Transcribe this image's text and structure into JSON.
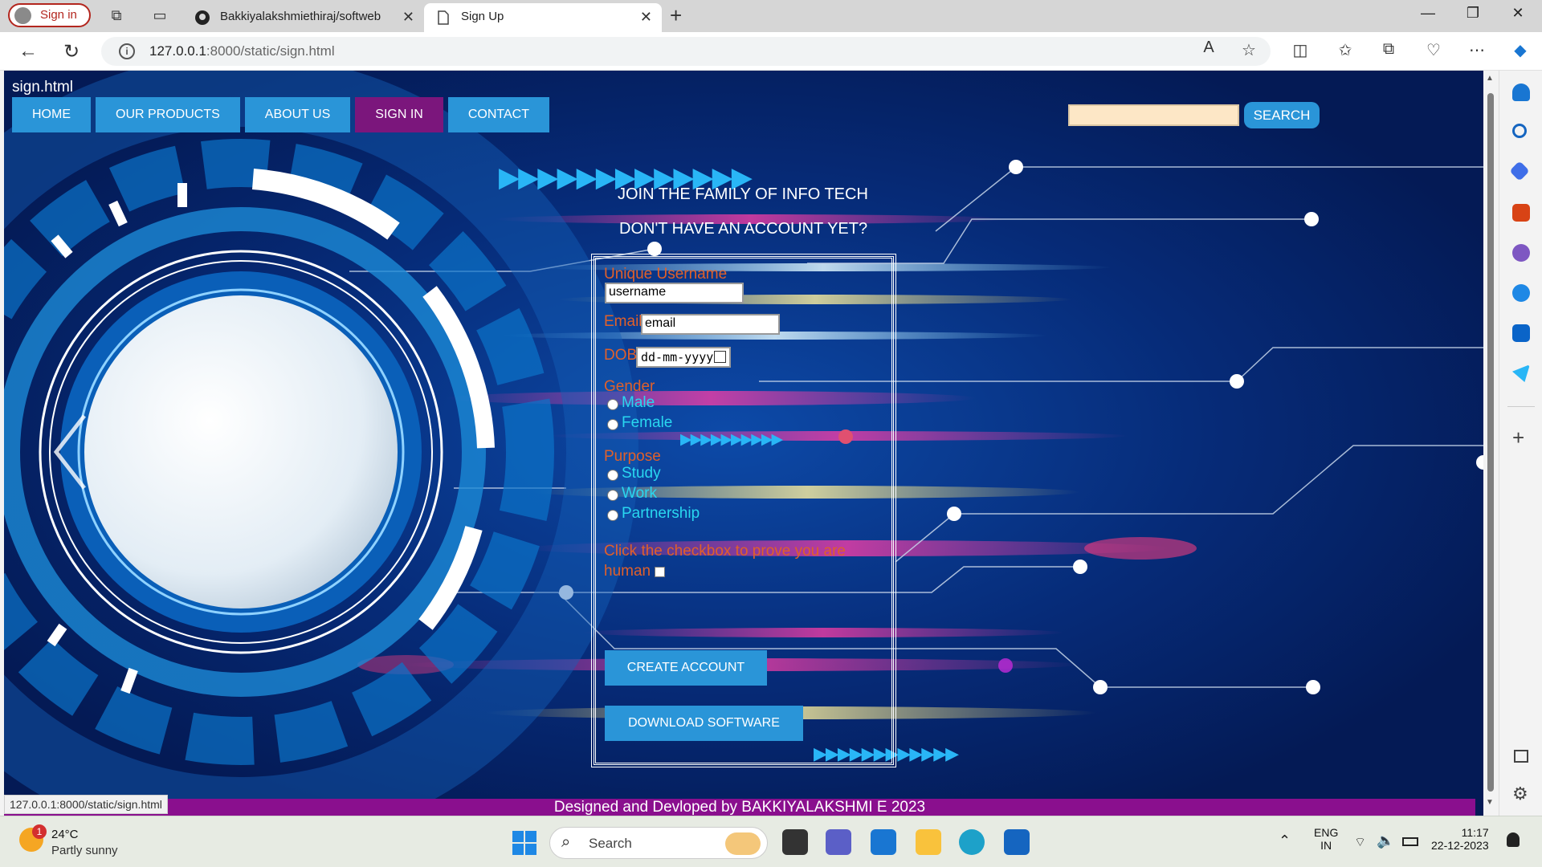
{
  "browser": {
    "profile_label": "Sign in",
    "tabs": [
      {
        "title": "Bakkiyalakshmiethiraj/softweb",
        "active": false
      },
      {
        "title": "Sign Up",
        "active": true
      }
    ],
    "url": "127.0.0.1:8000/static/sign.html",
    "url_host": "127.0.0.1",
    "url_path": ":8000/static/sign.html"
  },
  "page": {
    "title": "sign.html",
    "nav": [
      "HOME",
      "OUR PRODUCTS",
      "ABOUT US",
      "SIGN IN",
      "CONTACT"
    ],
    "search_button": "SEARCH",
    "heading_join": "JOIN THE FAMILY OF INFO TECH",
    "heading_account": "DON'T HAVE AN ACCOUNT YET?",
    "arrows_top": "▶▶▶▶▶▶▶▶▶▶▶▶▶",
    "arrows_mid": "▶▶▶▶▶▶▶▶▶▶",
    "arrows_bottom": "▶▶▶▶▶▶▶▶▶▶▶▶",
    "form": {
      "username_label": "Unique Username",
      "username_value": "username",
      "email_label": "Email",
      "email_value": "email",
      "dob_label": "DOB",
      "dob_placeholder": "dd-mm-yyyy",
      "gender_label": "Gender",
      "gender_options": [
        "Male",
        "Female"
      ],
      "purpose_label": "Purpose",
      "purpose_options": [
        "Study",
        "Work",
        "Partnership"
      ],
      "captcha_label_1": "Click the checkbox to prove you are",
      "captcha_label_2": "human",
      "create_button": "CREATE ACCOUNT",
      "download_button": "DOWNLOAD SOFTWARE"
    },
    "footer": "Designed and Devloped by BAKKIYALAKSHMI E 2023",
    "status_url": "127.0.0.1:8000/static/sign.html"
  },
  "taskbar": {
    "weather_temp": "24°C",
    "weather_desc": "Partly sunny",
    "weather_badge": "1",
    "search_placeholder": "Search",
    "lang_1": "ENG",
    "lang_2": "IN",
    "time": "11:17",
    "date": "22-12-2023"
  },
  "colors": {
    "nav_blue": "#2a95d8",
    "nav_active": "#7b167c",
    "label_orange": "#e0602a",
    "option_cyan": "#29d7f0",
    "footer_purple": "#8a0f8e"
  }
}
